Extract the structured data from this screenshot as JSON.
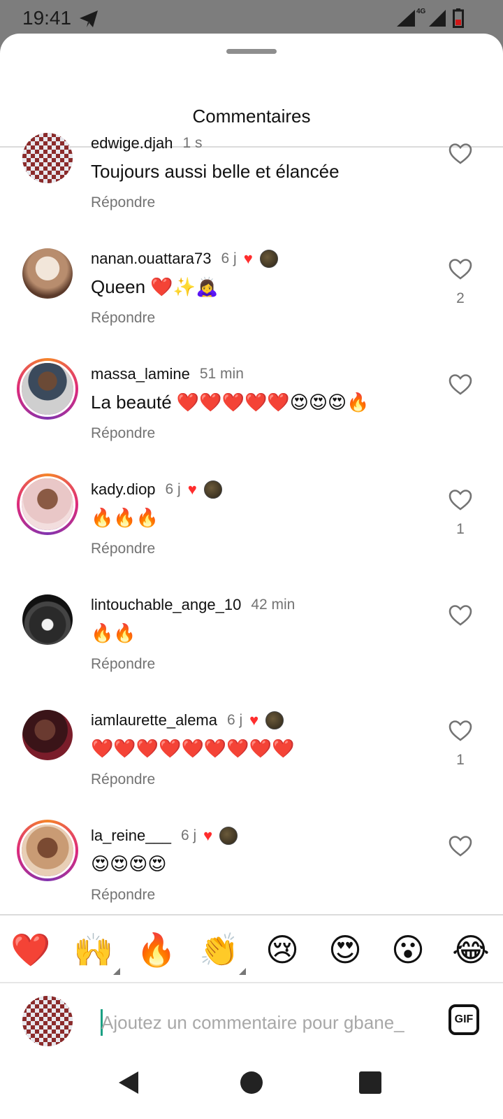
{
  "status_bar": {
    "time": "19:41",
    "network": "4G"
  },
  "header": {
    "title": "Commentaires"
  },
  "comments": [
    {
      "username": "edwige.djah",
      "time": "1 s",
      "text": "Toujours aussi belle et élancée",
      "reply": "Répondre",
      "likes": "",
      "liked_by_author": false,
      "avatar": "checkered"
    },
    {
      "username": "nanan.ouattara73",
      "time": "6 j",
      "text": "Queen ❤️✨🙇‍♀️",
      "reply": "Répondre",
      "likes": "2",
      "liked_by_author": true,
      "avatar": "photo-light"
    },
    {
      "username": "massa_lamine",
      "time": "51 min",
      "text": "La beauté ❤️❤️❤️❤️❤️😍😍😍🔥",
      "reply": "Répondre",
      "likes": "",
      "liked_by_author": false,
      "avatar": "photo-story"
    },
    {
      "username": "kady.diop",
      "time": "6 j",
      "text": "🔥🔥🔥",
      "reply": "Répondre",
      "likes": "1",
      "liked_by_author": true,
      "avatar": "photo-story-pink"
    },
    {
      "username": "lintouchable_ange_10",
      "time": "42 min",
      "text": "🔥🔥",
      "reply": "Répondre",
      "likes": "",
      "liked_by_author": false,
      "avatar": "dark-round"
    },
    {
      "username": "iamlaurette_alema",
      "time": "6 j",
      "text": "❤️❤️❤️❤️❤️❤️❤️❤️❤️",
      "reply": "Répondre",
      "likes": "1",
      "liked_by_author": true,
      "avatar": "photo-red"
    },
    {
      "username": "la_reine___",
      "time": "6 j",
      "text": "😍😍😍😍",
      "reply": "Répondre",
      "likes": "",
      "liked_by_author": true,
      "avatar": "photo-story-brown"
    }
  ],
  "reactions": [
    "❤️",
    "🙌",
    "🔥",
    "👏",
    "😢",
    "😍",
    "😮",
    "😂"
  ],
  "composer": {
    "placeholder": "Ajoutez un commentaire pour gbane_",
    "gif_label": "GIF"
  },
  "colors": {
    "like_red": "#ff2d2d",
    "muted": "#737373",
    "caret": "#1aa083"
  },
  "icons": {
    "like": "heart-outline-icon",
    "author_like": "heart-filled-icon",
    "nav": [
      "back-icon",
      "home-icon",
      "recents-icon"
    ]
  }
}
